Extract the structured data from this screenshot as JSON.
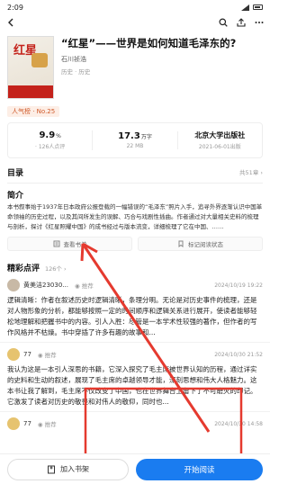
{
  "status": {
    "time": "2:09"
  },
  "book": {
    "cover_title": "红星",
    "title": "“红星”——世界是如何知道毛泽东的?",
    "author": "石川祯浩",
    "tags": "历史  · 历史",
    "rank": "人气榜 · No.25"
  },
  "stats": [
    {
      "value": "9.9",
      "unit": "%",
      "sub": "· 126人点评"
    },
    {
      "value": "17.3",
      "unit": "万字",
      "sub": "22 MB"
    },
    {
      "value": "北京大学出版社",
      "unit": "",
      "sub": "2021-06-01出版"
    }
  ],
  "toc": {
    "label": "目录",
    "count": "共51章"
  },
  "intro": {
    "label": "简介",
    "text": "本书叙事始于1937年日本政府公报登载的一幅错误的“毛泽东”照片入手，追寻外界逐渐认识中国革命领袖的历史过程，以及其间所发生的误解、巧合与戏剧性插曲。作者通过对大量相关史料的梳理与剖析，探讨《红星照耀中国》的成书经过与版本流变，详细梳理了它在中国、……"
  },
  "actions": {
    "view": "查看书单",
    "tag": "标记阅读状态"
  },
  "reviews_head": {
    "label": "精彩点评",
    "count": "126个"
  },
  "reviews": [
    {
      "name": "黄美洁23030...",
      "rec": "推荐",
      "date": "2024/10/19 19:22",
      "text": "逻辑清晰：作者在叙述历史时逻辑清晰，条理分明。无论是对历史事件的梳理，还是对人物形象的分析，都能够按照一定的时间顺序和逻辑关系进行展开，使读者能够轻松地理解和把握书中的内容。引人入胜：尽管是一本学术性较强的著作，但作者的写作风格并不枯燥。书中穿插了许多有趣的故事和..."
    },
    {
      "name": "77",
      "rec": "推荐",
      "date": "2024/10/30 21:52",
      "text": "我认为这是一本引人深思的书籍，它深入探究了毛主席被世界认知的历程，通过详实的史料和生动的叙述，展现了毛主席的卓越领导才能，深刻思想和伟大人格魅力。这本书让我了解到，毛主席不仅改变了中国，也在世界舞台上留下了不可磨灭的印记。它激发了读者对历史的敬畏和对伟人的敬仰，同时也..."
    },
    {
      "name": "77",
      "rec": "推荐",
      "date": "2024/10/30 14:58",
      "text": ""
    }
  ],
  "bottom": {
    "shelf": "加入书架",
    "read": "开始阅读"
  },
  "colors": {
    "accent": "#1a7cf0",
    "annotation": "#e53a2f"
  }
}
